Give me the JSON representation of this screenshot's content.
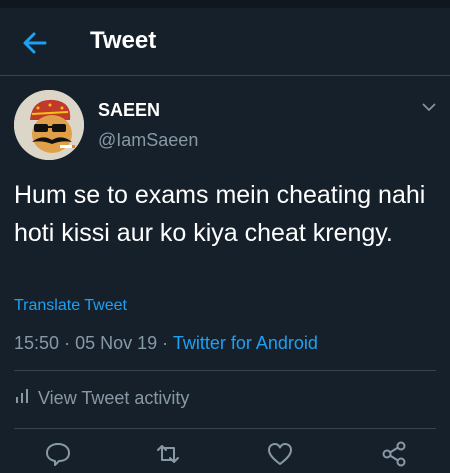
{
  "header": {
    "title": "Tweet"
  },
  "tweet": {
    "author_name": "SAEEN",
    "author_handle": "@IamSaeen",
    "text": "Hum se to exams mein cheating nahi hoti kissi aur ko kiya cheat krengy.",
    "translate_label": "Translate Tweet",
    "time": "15:50",
    "date": "05 Nov 19",
    "separator": "·",
    "source": "Twitter for Android"
  },
  "activity": {
    "label": "View Tweet activity"
  },
  "actions": [
    "reply-icon",
    "retweet-icon",
    "like-icon",
    "share-icon"
  ],
  "colors": {
    "background": "#15202b",
    "accent": "#1da1f2",
    "secondary_text": "#8899a6",
    "divider": "#38444d"
  }
}
